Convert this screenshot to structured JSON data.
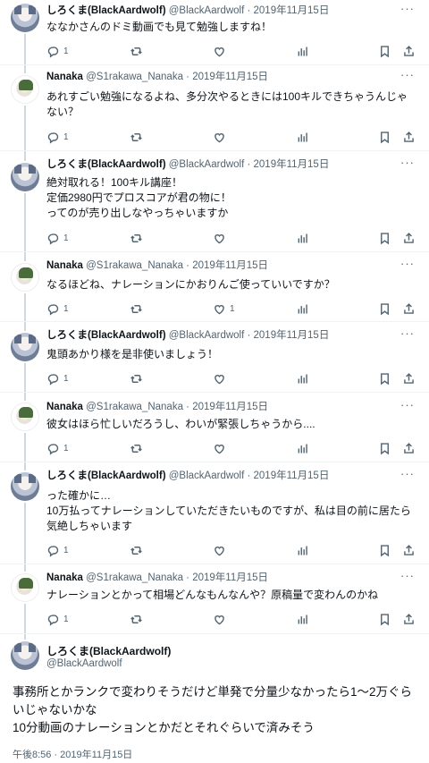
{
  "tweets": [
    {
      "author": "しろくま(BlackAardwolf)",
      "meta": "@BlackAardwolf · 2019年11月15日",
      "text": "ななかさんのドミ動画でも見て勉強しますね！",
      "replies": "1",
      "retweets": "",
      "likes": ""
    },
    {
      "author": "Nanaka",
      "meta": "@S1rakawa_Nanaka · 2019年11月15日",
      "text": "あれすごい勉強になるよね、多分次やるときには100キルできちゃうんじゃない？",
      "replies": "1",
      "retweets": "",
      "likes": ""
    },
    {
      "author": "しろくま(BlackAardwolf)",
      "meta": "@BlackAardwolf · 2019年11月15日",
      "text": "絶対取れる！100キル講座！\n定価2980円でプロスコアが君の物に！\nってのが売り出しなやっちゃいますか",
      "replies": "1",
      "retweets": "",
      "likes": ""
    },
    {
      "author": "Nanaka",
      "meta": "@S1rakawa_Nanaka · 2019年11月15日",
      "text": "なるほどね、ナレーションにかおりんご使っていいですか？",
      "replies": "1",
      "retweets": "",
      "likes": "1"
    },
    {
      "author": "しろくま(BlackAardwolf)",
      "meta": "@BlackAardwolf · 2019年11月15日",
      "text": "鬼頭あかり様を是非使いましょう！",
      "replies": "1",
      "retweets": "",
      "likes": ""
    },
    {
      "author": "Nanaka",
      "meta": "@S1rakawa_Nanaka · 2019年11月15日",
      "text": "彼女はほら忙しいだろうし、わいが緊張しちゃうから....",
      "replies": "1",
      "retweets": "",
      "likes": ""
    },
    {
      "author": "しろくま(BlackAardwolf)",
      "meta": "@BlackAardwolf · 2019年11月15日",
      "text": "った確かに…\n10万払ってナレーションしていただきたいものですが、私は目の前に居たら気絶しちゃいます",
      "replies": "1",
      "retweets": "",
      "likes": ""
    },
    {
      "author": "Nanaka",
      "meta": "@S1rakawa_Nanaka · 2019年11月15日",
      "text": "ナレーションとかって相場どんなもんなんや？原稿量で変わんのかね",
      "replies": "1",
      "retweets": "",
      "likes": ""
    }
  ],
  "main": {
    "author": "しろくま(BlackAardwolf)",
    "handle": "@BlackAardwolf",
    "text": "事務所とかランクで変わりそうだけど単発で分量少なかったら1〜2万ぐらいじゃないかな\n10分動画のナレーションとかだとそれぐらいで済みそう",
    "timestamp": "午後8:56 · 2019年11月15日"
  },
  "ui": {
    "more_icon": "more-icon",
    "reply_icon": "reply-icon",
    "retweet_icon": "retweet-icon",
    "like_icon": "like-icon",
    "views_icon": "views-icon",
    "bookmark_icon": "bookmark-icon",
    "share_icon": "share-icon"
  }
}
